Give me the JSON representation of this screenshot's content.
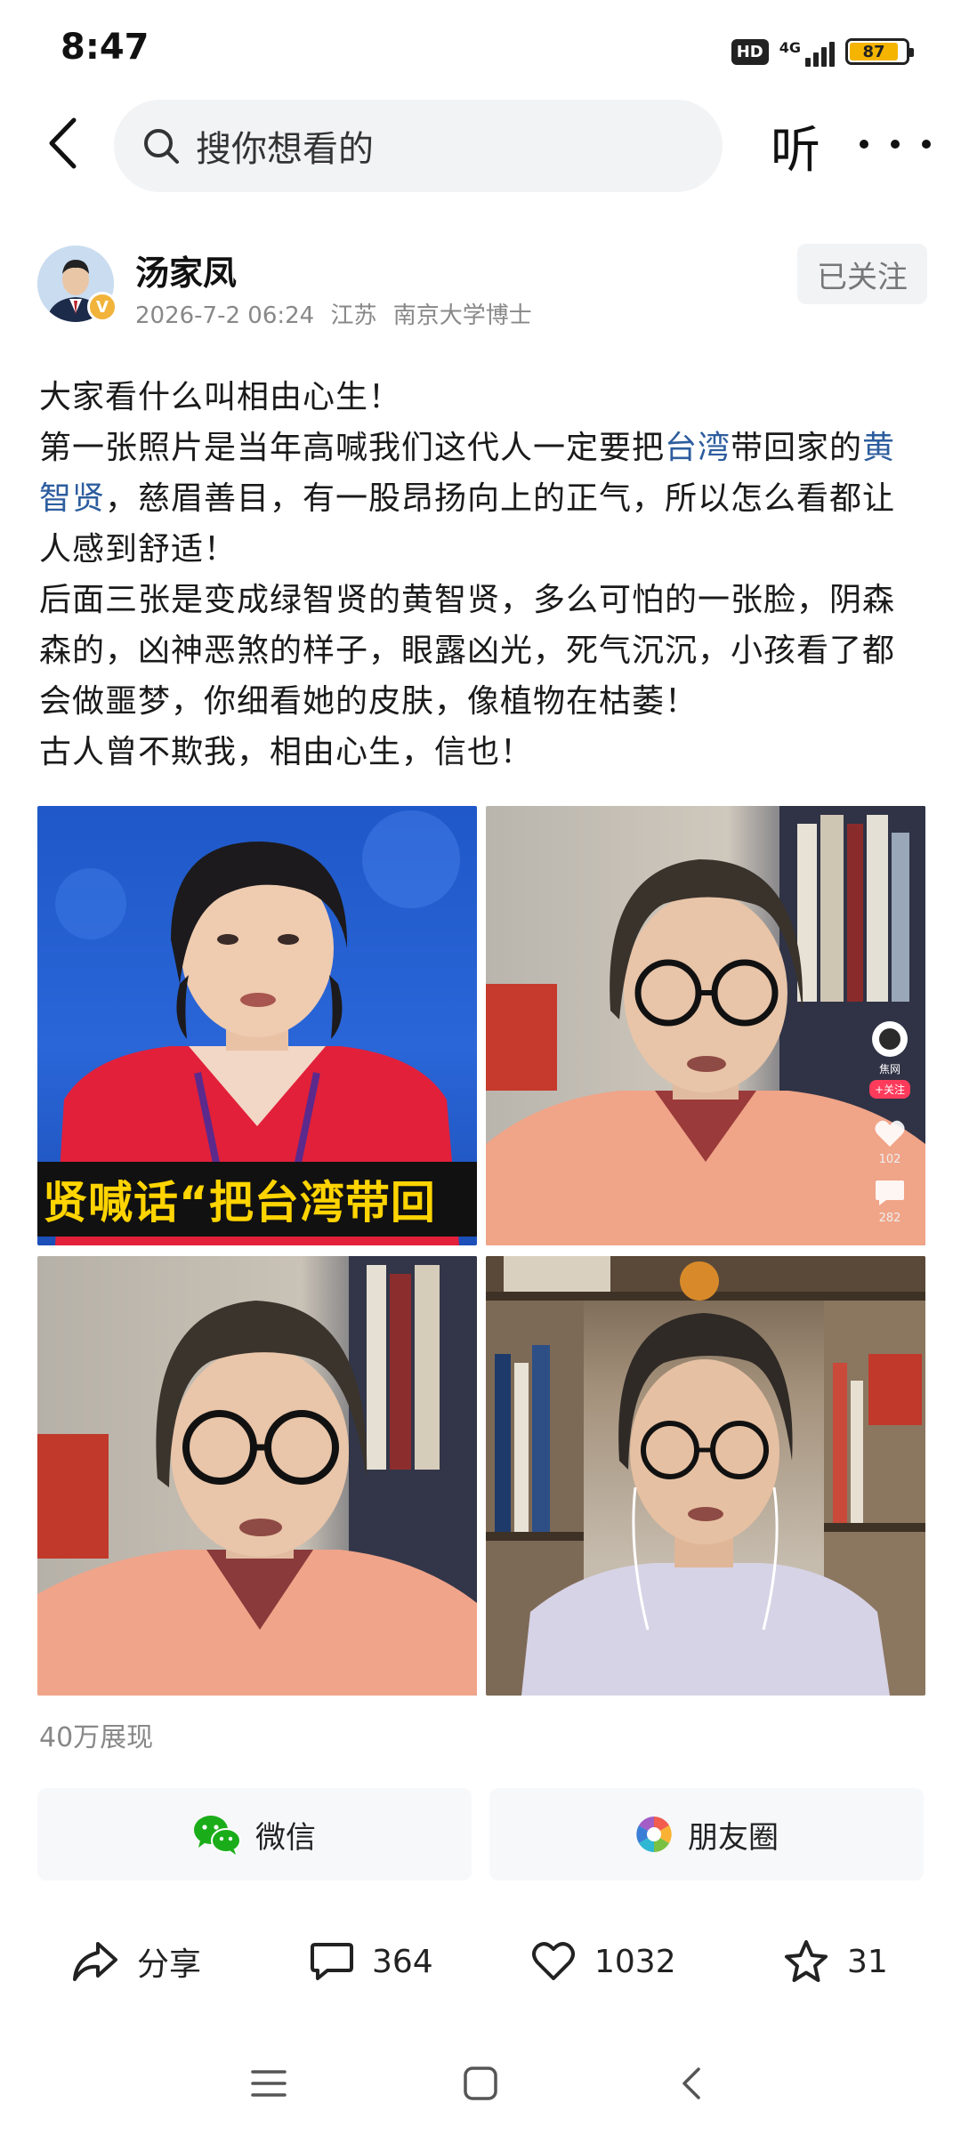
{
  "status_bar": {
    "time": "8:47",
    "hd": "HD",
    "network": "4G",
    "battery": "87",
    "battery_level": 0.87,
    "battery_color": "#f5b400"
  },
  "top_nav": {
    "search_placeholder": "搜你想看的",
    "listen_label": "听"
  },
  "author": {
    "name": "汤家凤",
    "date": "2026-7-2 06:24",
    "location": "江苏",
    "title": "南京大学博士",
    "verified": "V",
    "follow_label": "已关注"
  },
  "post": {
    "line1": "大家看什么叫相由心生！",
    "p2_a": "第一张照片是当年高喊我们这代人一定要把",
    "p2_tag1": "台湾",
    "p2_b": "带回家的",
    "p2_tag2": "黄智贤",
    "p2_c": "，慈眉善目，有一股昂扬向上的正气，所以怎么看都让人感到舒适！",
    "p3": "后面三张是变成绿智贤的黄智贤，多么可怕的一张脸，阴森森的，凶神恶煞的样子，眼露凶光，死气沉沉，小孩看了都会做噩梦，你细看她的皮肤，像植物在枯萎！",
    "p4": "古人曾不欺我，相由心生，信也！",
    "link_color": "#2d5d9e"
  },
  "images": {
    "caption_1": "贤喊话“把台湾带回",
    "overlay": {
      "account": "焦网",
      "follow": "+关注",
      "likes": "102",
      "comments": "282"
    }
  },
  "stats": {
    "views": "40万展现"
  },
  "share": {
    "wechat": "微信",
    "moments": "朋友圈"
  },
  "actions": {
    "share": "分享",
    "comments": "364",
    "likes": "1032",
    "favorites": "31"
  }
}
